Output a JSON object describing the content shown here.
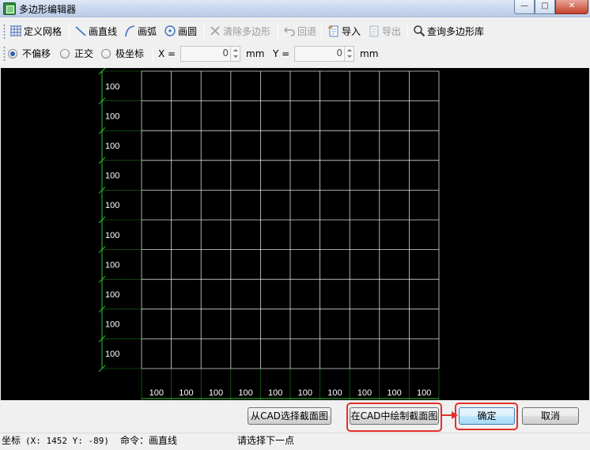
{
  "window": {
    "title": "多边形编辑器",
    "controls": {
      "minimize": "—",
      "maximize": "□",
      "close": "✕"
    }
  },
  "toolbar": {
    "items": [
      {
        "label": "定义网格",
        "icon": "grid-icon",
        "enabled": true
      },
      {
        "label": "画直线",
        "icon": "line-icon",
        "enabled": true
      },
      {
        "label": "画弧",
        "icon": "arc-icon",
        "enabled": true
      },
      {
        "label": "画圆",
        "icon": "circle-icon",
        "enabled": true
      },
      {
        "label": "清除多边形",
        "icon": "clear-icon",
        "enabled": false
      },
      {
        "label": "回退",
        "icon": "undo-icon",
        "enabled": false
      },
      {
        "label": "导入",
        "icon": "import-icon",
        "enabled": true
      },
      {
        "label": "导出",
        "icon": "export-icon",
        "enabled": false
      },
      {
        "label": "查询多边形库",
        "icon": "search-icon",
        "enabled": true
      }
    ]
  },
  "offset": {
    "options": [
      {
        "label": "不偏移",
        "checked": true
      },
      {
        "label": "正交",
        "checked": false
      },
      {
        "label": "极坐标",
        "checked": false
      }
    ],
    "x_label": "X =",
    "x_value": "0",
    "x_unit": "mm",
    "y_label": "Y =",
    "y_value": "0",
    "y_unit": "mm"
  },
  "grid": {
    "columns": [
      "100",
      "100",
      "100",
      "100",
      "100",
      "100",
      "100",
      "100",
      "100",
      "100"
    ],
    "rows": [
      "100",
      "100",
      "100",
      "100",
      "100",
      "100",
      "100",
      "100",
      "100",
      "100"
    ],
    "line_color": "#ffffff",
    "dimension_color": "#2fbf2f",
    "background": "#000000"
  },
  "buttons": {
    "select_from_cad": "从CAD选择截面图",
    "draw_in_cad": "在CAD中绘制截面图",
    "ok": "确定",
    "cancel": "取消"
  },
  "annotation": {
    "color": "#e0302a"
  },
  "status": {
    "coord_label": "坐标",
    "coord_value": "(X: 1452 Y: -89)",
    "command": "命令：画直线",
    "prompt": "请选择下一点"
  }
}
